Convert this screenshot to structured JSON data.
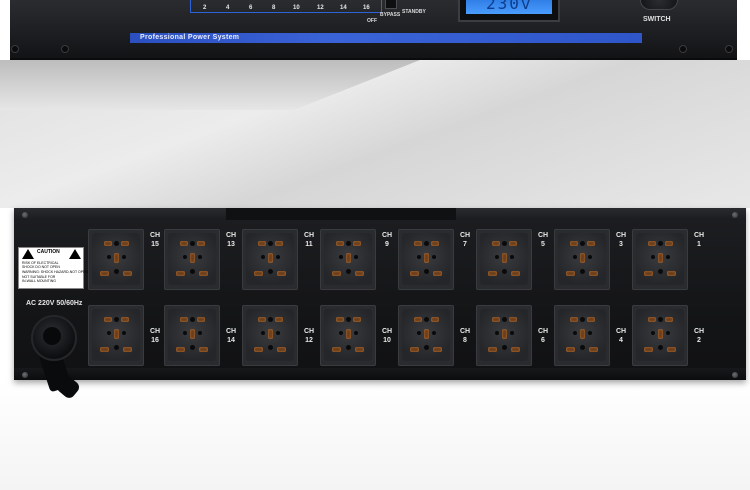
{
  "front_panel": {
    "scale_numbers": [
      "2",
      "4",
      "6",
      "8",
      "10",
      "12",
      "14",
      "16"
    ],
    "off_label": "OFF",
    "bypass_label": "BYPASS",
    "standby_label": "STANDBY",
    "switch_label": "SWITCH",
    "brand_text": "Professional  Power  System",
    "lcd_digits": "230v"
  },
  "rear_panel": {
    "caution": {
      "title": "CAUTION",
      "lines": [
        "RISK OF ELECTRICAL",
        "SHOCK DO NOT OPEN",
        "WARNING: SHOCK HAZARD-NOT OPEN",
        "NOT SUITABLE FOR",
        "IN-WALL MOUNTING"
      ]
    },
    "ac_label": "AC 220V  50/60Hz",
    "channel_prefix": "CH",
    "top_row_channels": [
      "15",
      "13",
      "11",
      "9",
      "7",
      "5",
      "3",
      "1"
    ],
    "bottom_row_channels": [
      "16",
      "14",
      "12",
      "10",
      "8",
      "6",
      "4",
      "2"
    ]
  },
  "colors": {
    "brand_strip": "#3a63d8",
    "chassis": "#1a1b1e",
    "lcd": "#4a9cff",
    "outlet_pins": "#6b3e1b"
  }
}
